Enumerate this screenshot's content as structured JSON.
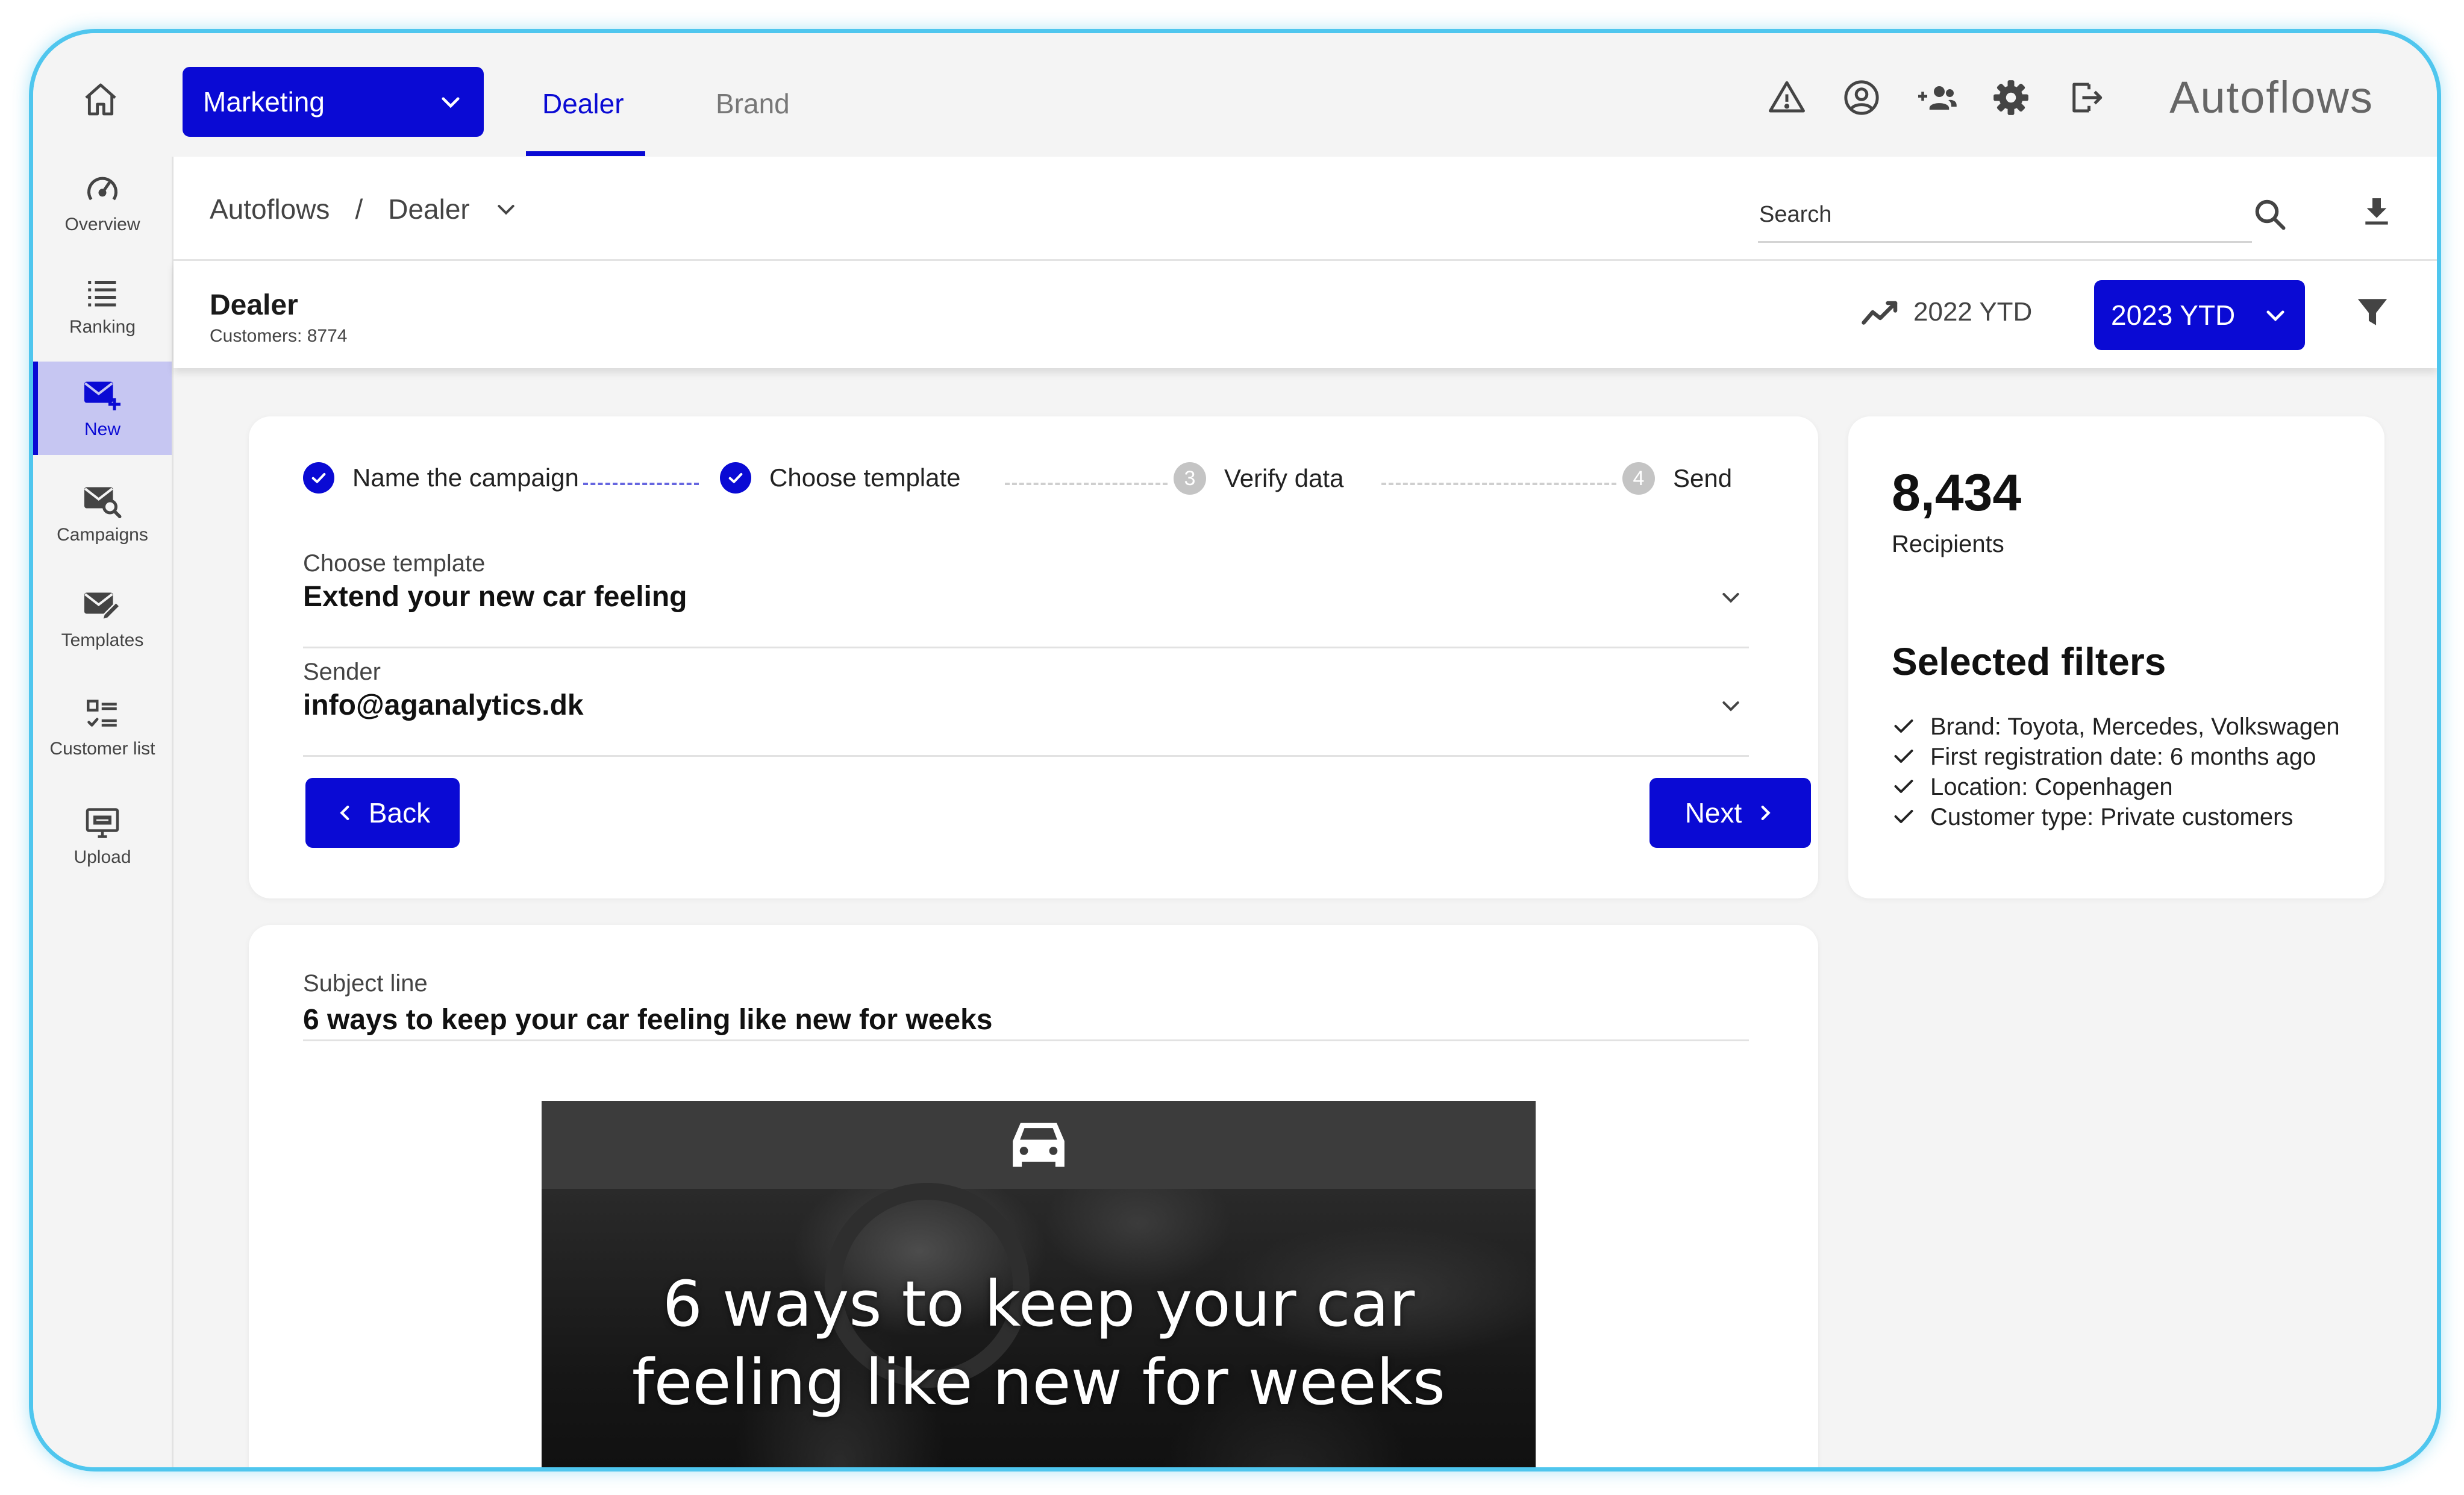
{
  "topbar": {
    "department_selected": "Marketing",
    "tabs": [
      {
        "label": "Dealer",
        "active": true
      },
      {
        "label": "Brand",
        "active": false
      }
    ],
    "app_name": "Autoflows",
    "icons": [
      "warning-icon",
      "account-icon",
      "add-users-icon",
      "gear-icon",
      "logout-icon"
    ]
  },
  "sidebar": {
    "items": [
      {
        "label": "Overview",
        "icon": "speedometer-icon"
      },
      {
        "label": "Ranking",
        "icon": "list-icon"
      },
      {
        "label": "New",
        "icon": "mail-plus-icon",
        "active": true
      },
      {
        "label": "Campaigns",
        "icon": "mail-search-icon"
      },
      {
        "label": "Templates",
        "icon": "mail-edit-icon"
      },
      {
        "label": "Customer list",
        "icon": "checklist-icon"
      },
      {
        "label": "Upload",
        "icon": "monitor-upload-icon"
      }
    ]
  },
  "breadcrumb": {
    "root": "Autoflows",
    "separator": "/",
    "current": "Dealer"
  },
  "search": {
    "placeholder": "Search"
  },
  "dealer": {
    "title": "Dealer",
    "customers": "Customers: 8774",
    "compare_period": "2022 YTD",
    "selected_period": "2023 YTD"
  },
  "wizard": {
    "steps": [
      {
        "label": "Name the campaign",
        "status": "done",
        "number": "1"
      },
      {
        "label": "Choose template",
        "status": "done",
        "number": "2"
      },
      {
        "label": "Verify data",
        "status": "pending",
        "number": "3"
      },
      {
        "label": "Send",
        "status": "pending",
        "number": "4"
      }
    ],
    "template_label": "Choose template",
    "template_value": "Extend your new car feeling",
    "sender_label": "Sender",
    "sender_value": "info@aganalytics.dk",
    "back_label": "Back",
    "next_label": "Next"
  },
  "summary": {
    "recipients_count": "8,434",
    "recipients_label": "Recipients",
    "filters_title": "Selected filters",
    "filters": [
      "Brand: Toyota, Mercedes, Volkswagen",
      "First registration date: 6 months ago",
      "Location: Copenhagen",
      "Customer type: Private customers"
    ]
  },
  "preview": {
    "subject_label": "Subject line",
    "subject_value": "6 ways to keep your car feeling like new for weeks",
    "headline_line1": "6 ways to keep your car",
    "headline_line2": "feeling like new for weeks"
  },
  "colors": {
    "primary": "#0a0ad4",
    "frame": "#4fc6ee",
    "active_sidebar_bg": "#c6c6f2",
    "background": "#f4f4f4"
  }
}
